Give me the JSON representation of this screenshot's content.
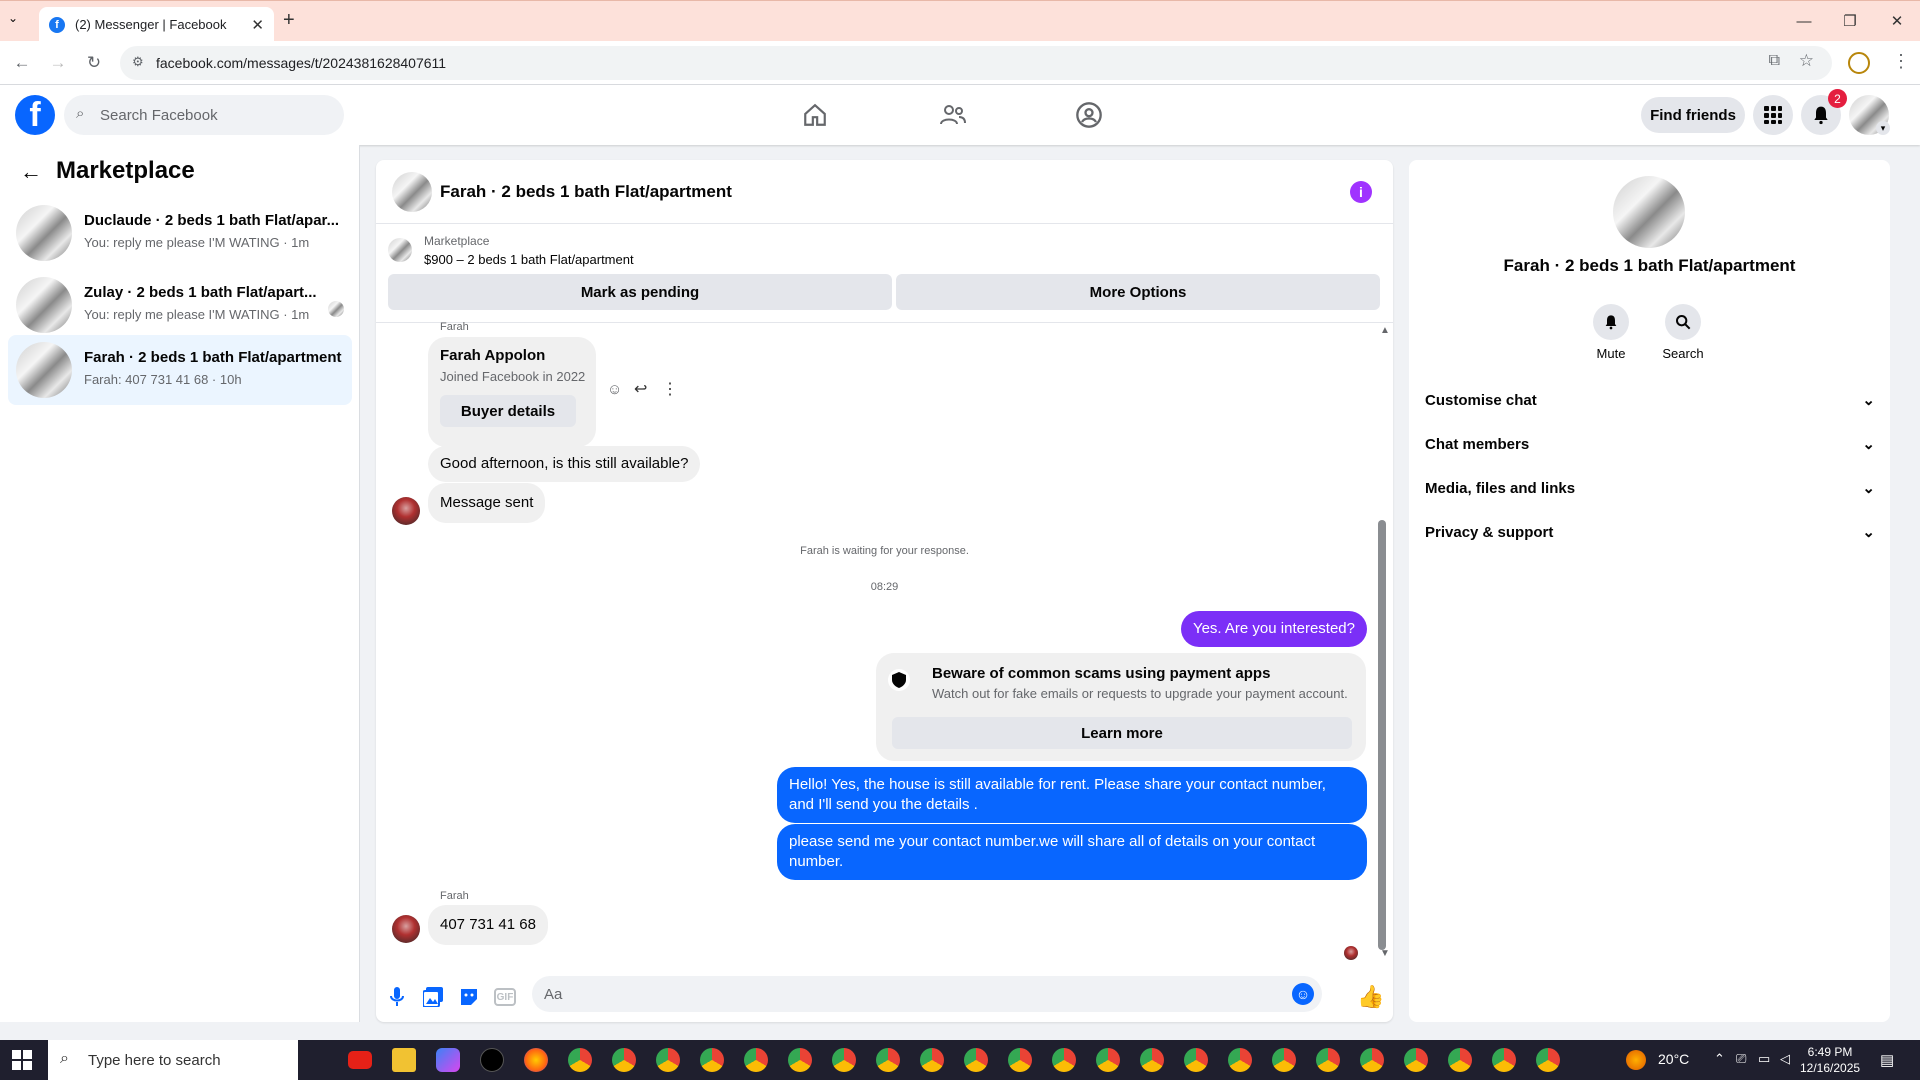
{
  "browser": {
    "tab_title": "(2) Messenger | Facebook",
    "url": "facebook.com/messages/t/2024381628407611"
  },
  "header": {
    "search_placeholder": "Search Facebook",
    "find_friends": "Find friends",
    "notification_count": "2"
  },
  "sidebar": {
    "title": "Marketplace",
    "conversations": [
      {
        "name": "Duclaude · 2 beds 1 bath Flat/apar...",
        "snippet": "You: reply me please I'M WATING · 1m"
      },
      {
        "name": "Zulay · 2 beds 1 bath Flat/apart...",
        "snippet": "You: reply me please I'M WATING · 1m"
      },
      {
        "name": "Farah · 2 beds 1 bath Flat/apartment",
        "snippet": "Farah: 407 731 41 68 · 10h"
      }
    ]
  },
  "chat": {
    "title": "Farah · 2 beds 1 bath Flat/apartment",
    "listing_label": "Marketplace",
    "listing_price": "$900 – 2 beds 1 bath Flat/apartment",
    "mark_pending": "Mark as pending",
    "more_options": "More Options",
    "sender_label": "Farah",
    "card_name": "Farah Appolon",
    "card_joined": "Joined Facebook in 2022",
    "buyer_details": "Buyer details",
    "msg_available": "Good afternoon, is this still available?",
    "msg_sent": "Message sent",
    "waiting": "Farah is waiting for your response.",
    "time": "08:29",
    "msg_interested": "Yes. Are you interested?",
    "scam_title": "Beware of common scams using payment apps",
    "scam_text": "Watch out for fake emails or requests to upgrade your payment account.",
    "learn_more": "Learn more",
    "msg_hello": "Hello! Yes, the house is still available for rent. Please share your contact number, and I'll send you the details .",
    "msg_contact": "please send me your contact number.we will share all of details on your contact number.",
    "sender_label2": "Farah",
    "msg_phone": "407 731 41 68",
    "composer_placeholder": "Aa"
  },
  "details": {
    "title": "Farah · 2 beds 1 bath Flat/apartment",
    "mute": "Mute",
    "search": "Search",
    "sections": [
      "Customise chat",
      "Chat members",
      "Media, files and links",
      "Privacy & support"
    ]
  },
  "taskbar": {
    "search": "Type here to search",
    "temp": "20°C",
    "time": "6:49 PM",
    "date": "12/16/2025"
  },
  "colors": {
    "accent": "#0866ff",
    "purple": "#a033ff"
  }
}
